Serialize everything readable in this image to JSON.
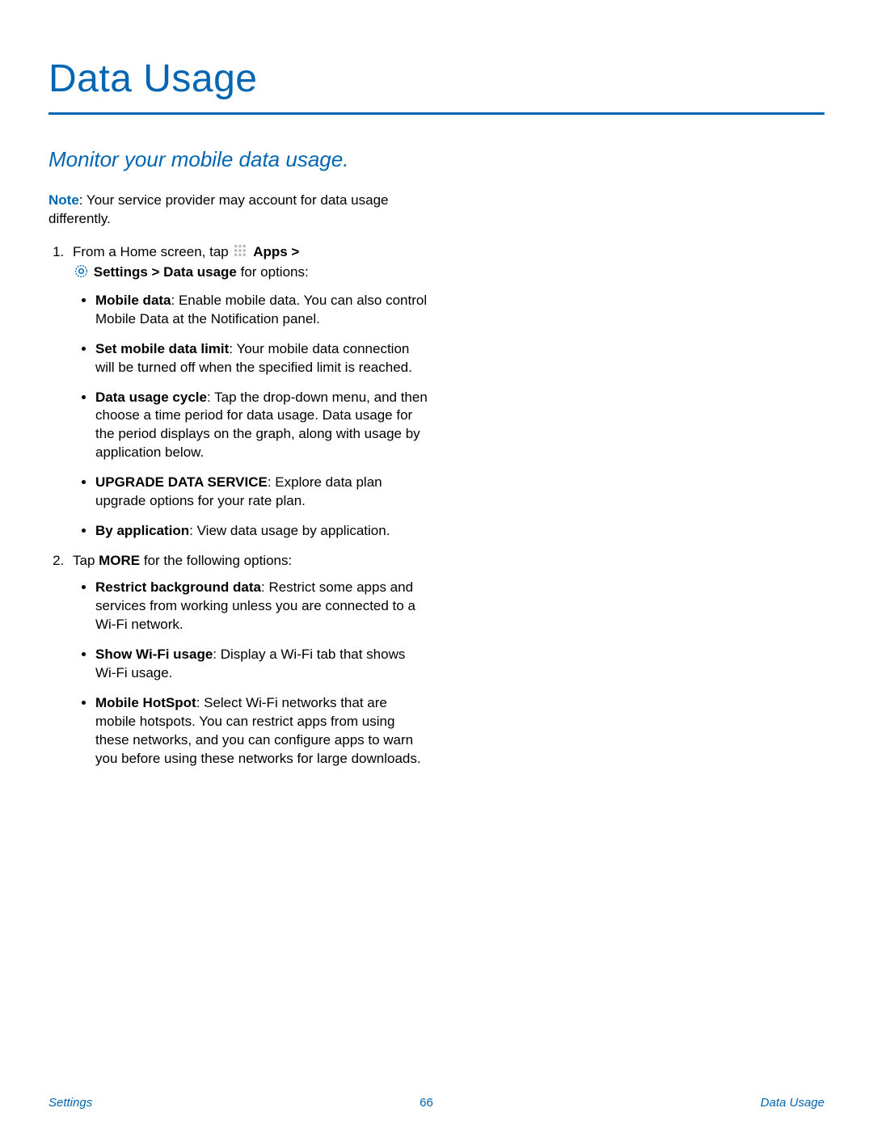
{
  "title": "Data Usage",
  "subtitle": "Monitor your mobile data usage.",
  "note": {
    "label": "Note",
    "text": ": Your service provider may account for data usage differently."
  },
  "step1": {
    "lead": "From a Home screen, tap ",
    "apps": "Apps",
    "gt1": " > ",
    "settings": "Settings",
    "gt2": "  > ",
    "datausage": "Data usage",
    "trail": " for options:"
  },
  "step1_bullets": [
    {
      "label": "Mobile data",
      "text": ": Enable mobile data. You can also control Mobile Data at the Notification panel."
    },
    {
      "label": "Set mobile data limit",
      "text": ": Your mobile data connection will be turned off when the specified limit is reached."
    },
    {
      "label": "Data usage cycle",
      "text": ": Tap the drop-down menu, and then choose a time period for data usage. Data usage for the period displays on the graph, along with usage by application below."
    },
    {
      "label": "UPGRADE DATA SERVICE",
      "text": ": Explore data plan upgrade options for your rate plan."
    },
    {
      "label": "By application",
      "text": ": View data usage by application."
    }
  ],
  "step2": {
    "lead": "Tap ",
    "more": "MORE",
    "trail": " for the following options:"
  },
  "step2_bullets": [
    {
      "label": "Restrict background data",
      "text": ": Restrict some apps and services from working unless you are connected to a Wi-Fi network."
    },
    {
      "label": "Show Wi-Fi usage",
      "text": ": Display a Wi-Fi tab that shows Wi-Fi usage."
    },
    {
      "label": "Mobile HotSpot",
      "text": ": Select Wi-Fi networks that are mobile hotspots. You can restrict apps from using these networks, and you can configure apps to warn you before using these networks for large downloads."
    }
  ],
  "footer": {
    "left": "Settings",
    "center": "66",
    "right": "Data Usage"
  }
}
